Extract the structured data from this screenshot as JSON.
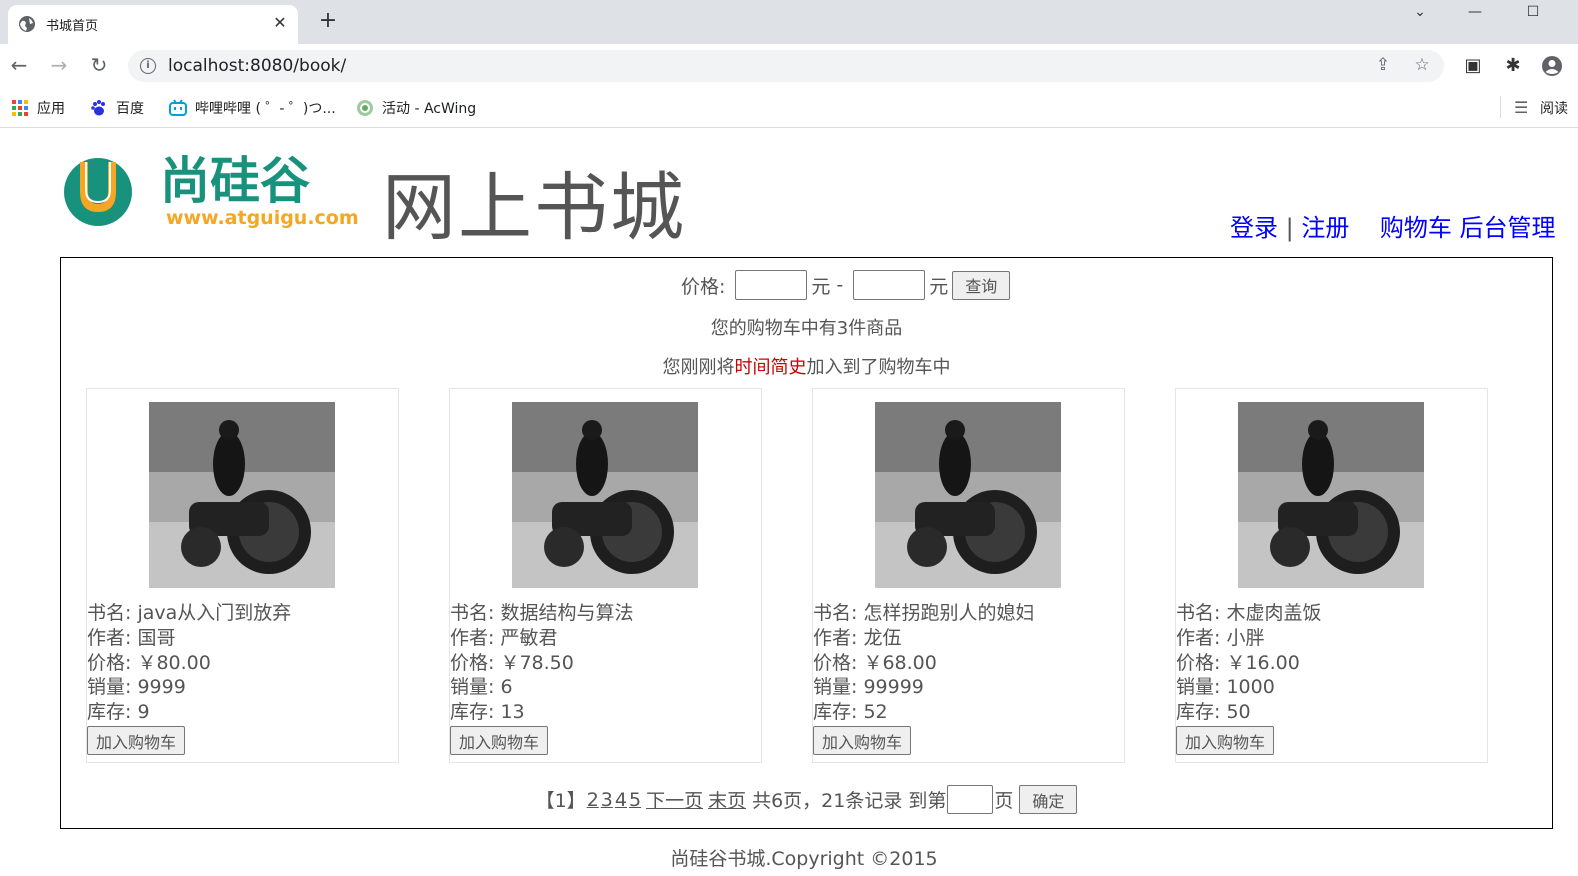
{
  "browser": {
    "tab_title": "书城首页",
    "url": "localhost:8080/book/",
    "bookmarks": [
      "应用",
      "百度",
      "哔哩哔哩 ( ゜- ゜)つ...",
      "活动 - AcWing"
    ],
    "reading_list": "阅读"
  },
  "header": {
    "logo_text": "尚硅谷",
    "logo_url": "www.atguigu.com",
    "title": "网上书城",
    "login": "登录",
    "separator": "|",
    "register": "注册",
    "cart": "购物车",
    "admin": "后台管理"
  },
  "search": {
    "price_label": "价格:",
    "unit": "元",
    "dash": "-",
    "query_button": "查询"
  },
  "cart_info": {
    "count_text": "您的购物车中有3件商品",
    "added_prefix": "您刚刚将",
    "added_book": "时间简史",
    "added_suffix": "加入到了购物车中"
  },
  "books": [
    {
      "name": "书名: java从入门到放弃",
      "author": "作者: 国哥",
      "price": "价格: ￥80.00",
      "sales": "销量: 9999",
      "stock": "库存: 9",
      "button": "加入购物车"
    },
    {
      "name": "书名: 数据结构与算法",
      "author": "作者: 严敏君",
      "price": "价格: ￥78.50",
      "sales": "销量: 6",
      "stock": "库存: 13",
      "button": "加入购物车"
    },
    {
      "name": "书名: 怎样拐跑别人的媳妇",
      "author": "作者: 龙伍",
      "price": "价格: ￥68.00",
      "sales": "销量: 99999",
      "stock": "库存: 52",
      "button": "加入购物车"
    },
    {
      "name": "书名: 木虚肉盖饭",
      "author": "作者: 小胖",
      "price": "价格: ￥16.00",
      "sales": "销量: 1000",
      "stock": "库存: 50",
      "button": "加入购物车"
    }
  ],
  "pager": {
    "current": "【1】",
    "pages": [
      "2",
      "3",
      "4",
      "5"
    ],
    "next": "下一页",
    "last": "末页",
    "summary": "共6页，21条记录",
    "goto_prefix": "到第",
    "goto_suffix": "页",
    "confirm": "确定"
  },
  "footer": "尚硅谷书城.Copyright ©2015"
}
